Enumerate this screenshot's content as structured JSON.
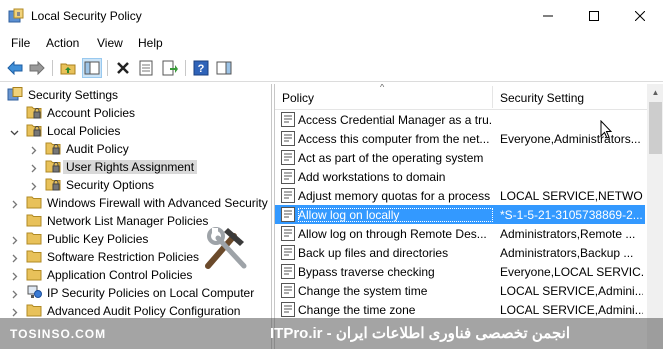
{
  "window": {
    "title": "Local Security Policy"
  },
  "menu": [
    "File",
    "Action",
    "View",
    "Help"
  ],
  "tree": [
    {
      "label": "Security Settings",
      "arrow": "none",
      "icon": "shield-icon"
    },
    {
      "label": "Account Policies",
      "arrow": "right",
      "icon": "folder-lock-icon"
    },
    {
      "label": "Local Policies",
      "arrow": "down",
      "icon": "folder-lock-icon"
    },
    {
      "label": "Audit Policy",
      "arrow": "right",
      "icon": "folder-lock-icon"
    },
    {
      "label": "User Rights Assignment",
      "arrow": "right",
      "icon": "folder-lock-icon",
      "selected": true
    },
    {
      "label": "Security Options",
      "arrow": "right",
      "icon": "folder-lock-icon"
    },
    {
      "label": "Windows Firewall with Advanced Security",
      "arrow": "right",
      "icon": "folder-icon"
    },
    {
      "label": "Network List Manager Policies",
      "arrow": "none",
      "icon": "folder-icon"
    },
    {
      "label": "Public Key Policies",
      "arrow": "right",
      "icon": "folder-icon"
    },
    {
      "label": "Software Restriction Policies",
      "arrow": "right",
      "icon": "folder-icon"
    },
    {
      "label": "Application Control Policies",
      "arrow": "right",
      "icon": "folder-icon"
    },
    {
      "label": "IP Security Policies on Local Computer",
      "arrow": "right",
      "icon": "network-policy-icon"
    },
    {
      "label": "Advanced Audit Policy Configuration",
      "arrow": "right",
      "icon": "folder-icon"
    }
  ],
  "list": {
    "columns": [
      "Policy",
      "Security Setting"
    ],
    "rows": [
      {
        "policy": "Access Credential Manager as a tru...",
        "setting": ""
      },
      {
        "policy": "Access this computer from the net...",
        "setting": "Everyone,Administrators..."
      },
      {
        "policy": "Act as part of the operating system",
        "setting": ""
      },
      {
        "policy": "Add workstations to domain",
        "setting": ""
      },
      {
        "policy": "Adjust memory quotas for a process",
        "setting": "LOCAL SERVICE,NETWO..."
      },
      {
        "policy": "Allow log on locally",
        "setting": "*S-1-5-21-3105738869-2...",
        "selected": true
      },
      {
        "policy": "Allow log on through Remote Des...",
        "setting": "Administrators,Remote ..."
      },
      {
        "policy": "Back up files and directories",
        "setting": "Administrators,Backup ..."
      },
      {
        "policy": "Bypass traverse checking",
        "setting": "Everyone,LOCAL SERVIC..."
      },
      {
        "policy": "Change the system time",
        "setting": "LOCAL SERVICE,Admini..."
      },
      {
        "policy": "Change the time zone",
        "setting": "LOCAL SERVICE,Admini..."
      }
    ]
  },
  "watermark": {
    "left": "TOSINSO.COM",
    "right": "ITPro.ir - انجمن تخصصی فناوری اطلاعات ایران"
  },
  "colors": {
    "selection": "#3399ff",
    "tree_selection": "#d9d9d9",
    "folder": "#e8c15a"
  }
}
